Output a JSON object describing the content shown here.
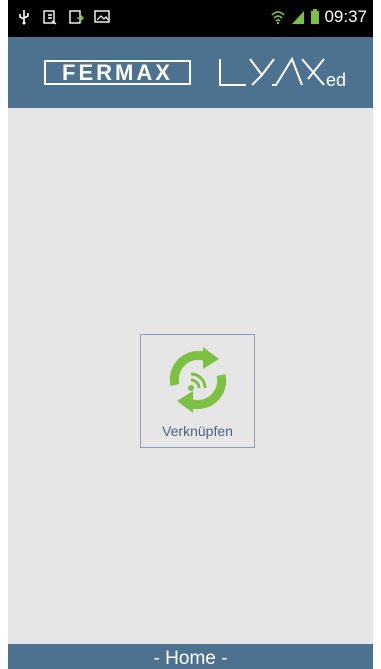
{
  "status_bar": {
    "time": "09:37",
    "icons": [
      "usb-icon",
      "download-icon",
      "upload-icon",
      "image-icon",
      "wifi-icon",
      "signal-icon",
      "battery-icon"
    ]
  },
  "header": {
    "brand": "FERMAX",
    "product": "LYNXed"
  },
  "main": {
    "link_button_label": "Verknüpfen",
    "accent_color": "#7dc143"
  },
  "footer": {
    "title": "- Home -"
  }
}
